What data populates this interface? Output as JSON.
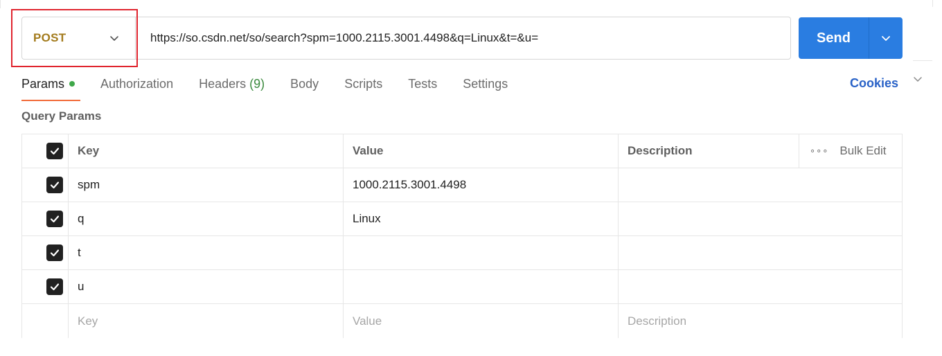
{
  "request": {
    "method": "POST",
    "url": "https://so.csdn.net/so/search?spm=1000.2115.3001.4498&q=Linux&t=&u="
  },
  "send": {
    "label": "Send"
  },
  "tabs": [
    {
      "label": "Params",
      "active": true
    },
    {
      "label": "Authorization"
    },
    {
      "label": "Headers",
      "count": "(9)"
    },
    {
      "label": "Body"
    },
    {
      "label": "Scripts"
    },
    {
      "label": "Tests"
    },
    {
      "label": "Settings"
    }
  ],
  "cookies_label": "Cookies",
  "section_title": "Query Params",
  "table": {
    "headers": {
      "key": "Key",
      "value": "Value",
      "description": "Description",
      "bulk_edit": "Bulk Edit"
    },
    "rows": [
      {
        "key": "spm",
        "value": "1000.2115.3001.4498",
        "description": "",
        "checked": true
      },
      {
        "key": "q",
        "value": "Linux",
        "description": "",
        "checked": true
      },
      {
        "key": "t",
        "value": "",
        "description": "",
        "checked": true
      },
      {
        "key": "u",
        "value": "",
        "description": "",
        "checked": true
      }
    ],
    "placeholders": {
      "key": "Key",
      "value": "Value",
      "description": "Description"
    }
  },
  "colors": {
    "method": "#a37b1d",
    "send_button": "#2a7de1",
    "active_tab_underline": "#f26b3a",
    "cookies_link": "#2962c7",
    "highlight_box": "#e0242e",
    "headers_count": "#3b8a3e",
    "params_dot": "#3fa84a"
  },
  "icons": {
    "method_dropdown": "chevron-down-icon",
    "send_dropdown": "chevron-down-icon",
    "bulk_menu": "more-horizontal-icon",
    "checkbox": "checkmark-icon"
  }
}
